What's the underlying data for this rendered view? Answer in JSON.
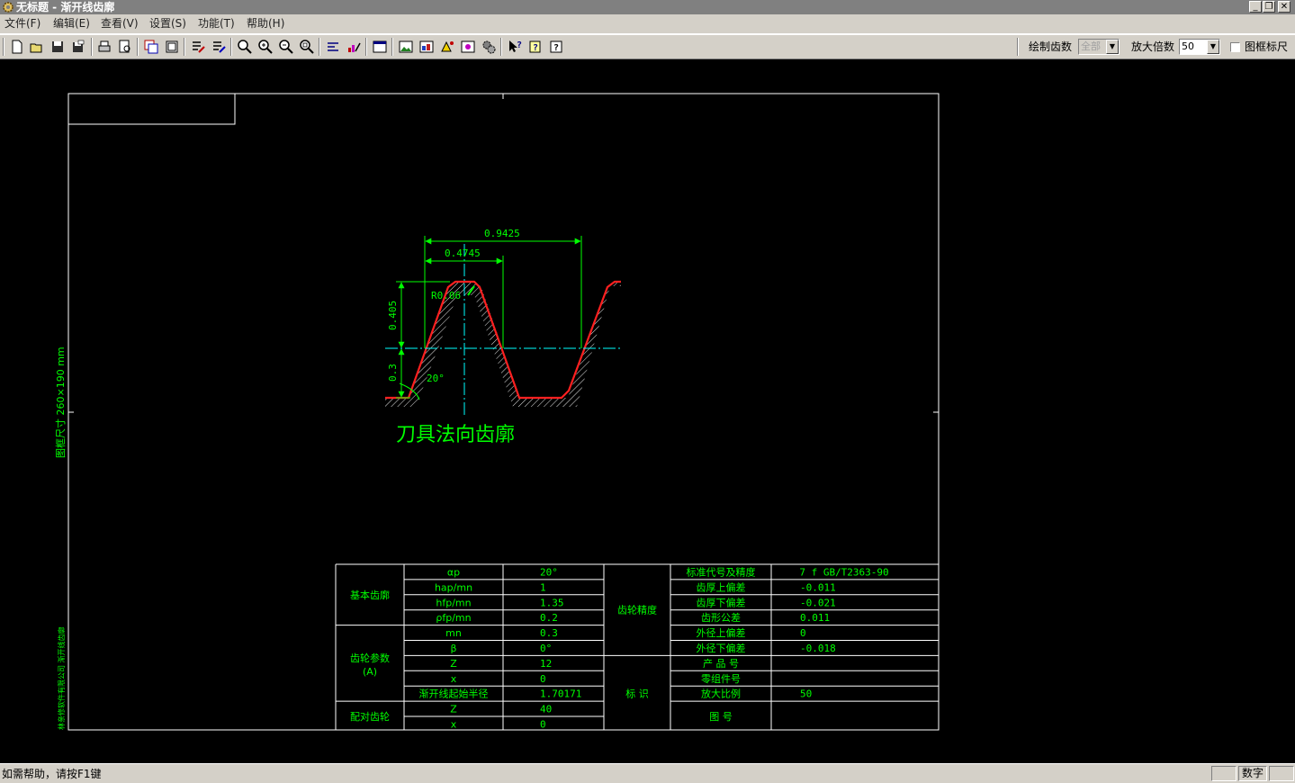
{
  "window": {
    "title": "无标题 - 渐开线齿廓",
    "controls": [
      "_",
      "❐",
      "✕"
    ]
  },
  "menu": [
    "文件(F)",
    "编辑(E)",
    "查看(V)",
    "设置(S)",
    "功能(T)",
    "帮助(H)"
  ],
  "toolbar": {
    "icons": [
      "new-file",
      "open-folder",
      "save",
      "save-as",
      "print",
      "print-preview",
      "copy-frame",
      "frame",
      "edit-a",
      "edit-b",
      "zoom-in",
      "zoom-in-2",
      "zoom-fit",
      "zoom-window",
      "align-text",
      "edit-chart",
      "settings-panel",
      "image-a",
      "image-b",
      "image-c",
      "image-d",
      "gears",
      "context-help",
      "note-help",
      "about-help"
    ],
    "gear_count_label": "绘制齿数",
    "gear_count_value": "全部",
    "zoom_label": "放大倍数",
    "zoom_value": "50",
    "frame_ruler_label": "图框标尺"
  },
  "drawing": {
    "frame_size_label": "图框尺寸  260×190 mm",
    "company_label": "林亲修软件有限公司  渐开线齿廓",
    "profile_title": "刀具法向齿廓",
    "dimensions": {
      "pitch": "0.9425",
      "half_pitch": "0.4745",
      "addendum": "0.405",
      "dedendum": "0.3",
      "tip_radius": "R0.06",
      "pressure_angle": "20°"
    },
    "table": {
      "basic_profile_label": "基本齿廓",
      "gear_params_label": "齿轮参数\n(A)",
      "mating_gear_label": "配对齿轮",
      "accuracy_label": "齿轮精度",
      "marking_label": "标    识",
      "rows_left": [
        {
          "name": "αp",
          "value": "20°"
        },
        {
          "name": "hap/mn",
          "value": "1"
        },
        {
          "name": "hfp/mn",
          "value": "1.35"
        },
        {
          "name": "ρfp/mn",
          "value": "0.2"
        },
        {
          "name": "mn",
          "value": "0.3"
        },
        {
          "name": "β",
          "value": "0°"
        },
        {
          "name": "Z",
          "value": "12"
        },
        {
          "name": "x",
          "value": "0"
        },
        {
          "name": "渐开线起始半径",
          "value": "1.70171"
        },
        {
          "name": "Z",
          "value": "40"
        },
        {
          "name": "x",
          "value": "0"
        }
      ],
      "rows_right": [
        {
          "name": "标准代号及精度",
          "value": "7 f GB/T2363-90"
        },
        {
          "name": "齿厚上偏差",
          "value": "-0.011"
        },
        {
          "name": "齿厚下偏差",
          "value": "-0.021"
        },
        {
          "name": "齿形公差",
          "value": "0.011"
        },
        {
          "name": "外径上偏差",
          "value": "0"
        },
        {
          "name": "外径下偏差",
          "value": "-0.018"
        },
        {
          "name": "产 品 号",
          "value": ""
        },
        {
          "name": "零组件号",
          "value": ""
        },
        {
          "name": "放大比例",
          "value": "50"
        },
        {
          "name": "图    号",
          "value": ""
        }
      ]
    }
  },
  "status": {
    "help_text": "如需帮助，请按F1键",
    "num_indicator": "数字"
  },
  "colors": {
    "canvas": "#000000",
    "frame": "#ffffff",
    "dimension": "#00ff00",
    "table_text": "#00ff00",
    "profile": "#ff2020",
    "center_line": "#00ffff"
  }
}
